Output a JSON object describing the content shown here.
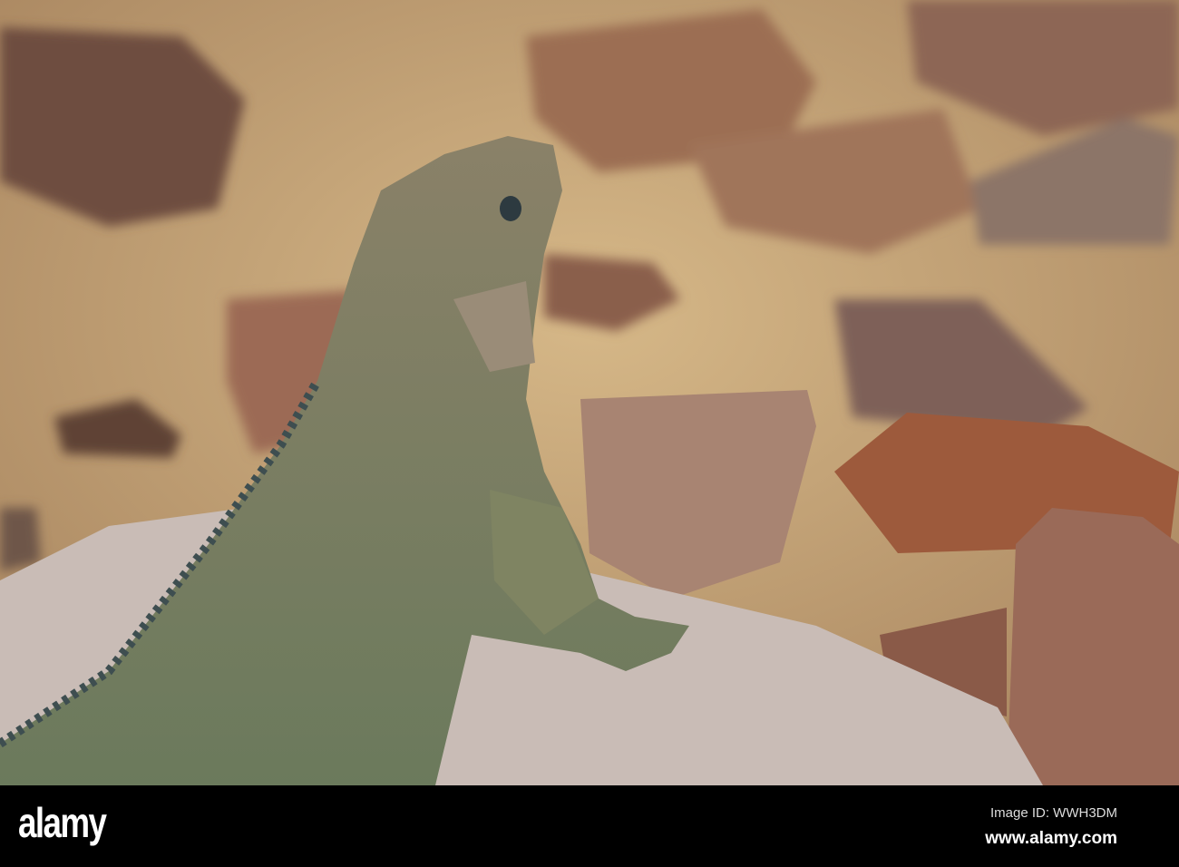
{
  "photo": {
    "subject": "iguana on rocks"
  },
  "watermark": {
    "logo": "alamy",
    "image_id": "Image ID: WWH3DM",
    "site": "www.alamy.com"
  },
  "colors": {
    "sand": "#c9a878",
    "rock": "#8e6a55",
    "iguana": "#7d7c62",
    "bar": "#000000"
  }
}
